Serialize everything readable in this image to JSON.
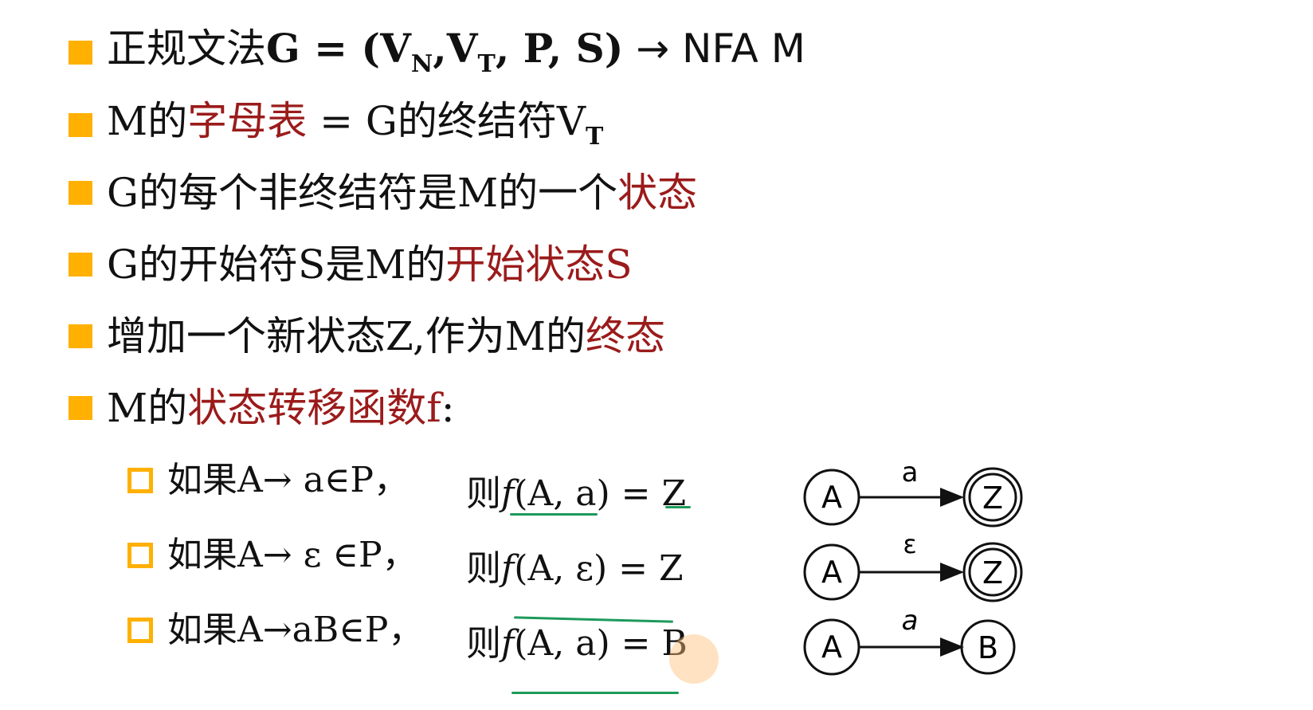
{
  "bullets": [
    {
      "id": "b1",
      "parts": {
        "a": "正规文法",
        "b": "G = (V",
        "c": "N",
        "d": ",V",
        "e": "T",
        "f": ", P, S)",
        "g": " → NFA M"
      }
    },
    {
      "id": "b2",
      "parts": {
        "a": "M的",
        "b": "字母表",
        "c": " = G的终结符V",
        "d": "T"
      }
    },
    {
      "id": "b3",
      "parts": {
        "a": "G的每个非终结符是M的一个",
        "b": "状态"
      }
    },
    {
      "id": "b4",
      "parts": {
        "a": "G的开始符S是M的",
        "b": "开始状态S"
      }
    },
    {
      "id": "b5",
      "parts": {
        "a": "增加一个新状态Z,作为M的",
        "b": "终态"
      }
    },
    {
      "id": "b6",
      "parts": {
        "a": "M的",
        "b": "状态转移函数f",
        ":": ":"
      }
    }
  ],
  "rules": [
    {
      "condition": "如果A→ a∈P，",
      "then": "则",
      "func": "f",
      "args": "(A, a) = Z",
      "diagram": {
        "from": "A",
        "label": "a",
        "to": "Z",
        "final": true,
        "italic": false
      }
    },
    {
      "condition": "如果A→ ε ∈P，",
      "then": "则",
      "func": "f",
      "args": "(A, ε) = Z",
      "diagram": {
        "from": "A",
        "label": "ε",
        "to": "Z",
        "final": true,
        "italic": false
      }
    },
    {
      "condition": "如果A→aB∈P，",
      "then": "则",
      "func": "f",
      "args": "(A, a) = B",
      "diagram": {
        "from": "A",
        "label": "a",
        "to": "B",
        "final": false,
        "italic": true
      }
    }
  ],
  "colors": {
    "bullet": "#ffb000",
    "highlight": "#9b1b1b",
    "annotation": "#1d9a5a"
  }
}
